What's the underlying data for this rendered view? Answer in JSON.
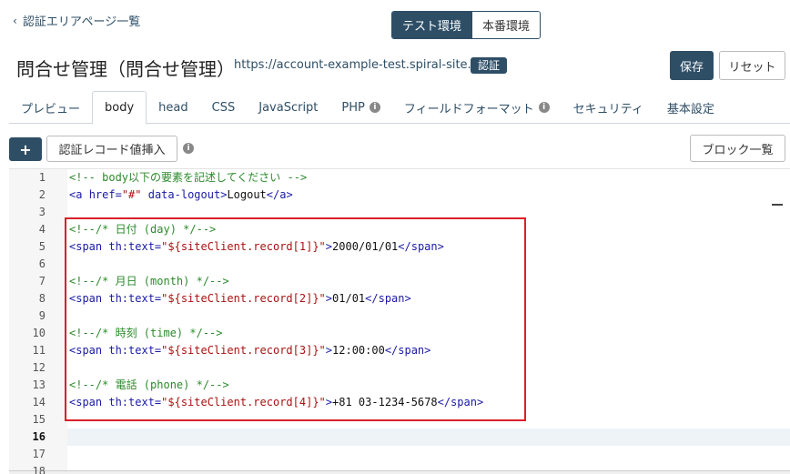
{
  "nav": {
    "back_label": "認証エリアページ一覧"
  },
  "env": {
    "test_label": "テスト環境",
    "prod_label": "本番環境"
  },
  "header": {
    "title": "問合せ管理（問合せ管理）",
    "url": "https://account-example-test.spiral-site.com",
    "badge": "認証",
    "save_label": "保存",
    "reset_label": "リセット"
  },
  "tabs": [
    {
      "label": "プレビュー",
      "info": false
    },
    {
      "label": "body",
      "info": false,
      "active": true
    },
    {
      "label": "head",
      "info": false
    },
    {
      "label": "CSS",
      "info": false
    },
    {
      "label": "JavaScript",
      "info": false
    },
    {
      "label": "PHP",
      "info": true
    },
    {
      "label": "フィールドフォーマット",
      "info": true
    },
    {
      "label": "セキュリティ",
      "info": false
    },
    {
      "label": "基本設定",
      "info": false
    }
  ],
  "toolbar": {
    "plus_label": "+",
    "insert_label": "認証レコード値挿入",
    "block_label": "ブロック一覧"
  },
  "editor": {
    "current_line": 16,
    "line_numbers": [
      "1",
      "2",
      "3",
      "4",
      "5",
      "6",
      "7",
      "8",
      "9",
      "10",
      "11",
      "12",
      "13",
      "14",
      "15",
      "16",
      "17",
      "18"
    ],
    "lines": [
      [
        {
          "t": "comment",
          "v": "<!-- body以下の要素を記述してください -->"
        }
      ],
      [
        {
          "t": "tag",
          "v": "<a "
        },
        {
          "t": "attr",
          "v": "href="
        },
        {
          "t": "str",
          "v": "\"#\""
        },
        {
          "t": "attr",
          "v": " data-logout"
        },
        {
          "t": "tag",
          "v": ">"
        },
        {
          "t": "text",
          "v": "Logout"
        },
        {
          "t": "tag",
          "v": "</a>"
        }
      ],
      [],
      [
        {
          "t": "comment",
          "v": "<!--/* 日付 (day) */-->"
        }
      ],
      [
        {
          "t": "tag",
          "v": "<span "
        },
        {
          "t": "attr",
          "v": "th:text="
        },
        {
          "t": "str",
          "v": "\"${siteClient.record[1]}\""
        },
        {
          "t": "tag",
          "v": ">"
        },
        {
          "t": "text",
          "v": "2000/01/01"
        },
        {
          "t": "tag",
          "v": "</span>"
        }
      ],
      [],
      [
        {
          "t": "comment",
          "v": "<!--/* 月日 (month) */-->"
        }
      ],
      [
        {
          "t": "tag",
          "v": "<span "
        },
        {
          "t": "attr",
          "v": "th:text="
        },
        {
          "t": "str",
          "v": "\"${siteClient.record[2]}\""
        },
        {
          "t": "tag",
          "v": ">"
        },
        {
          "t": "text",
          "v": "01/01"
        },
        {
          "t": "tag",
          "v": "</span>"
        }
      ],
      [],
      [
        {
          "t": "comment",
          "v": "<!--/* 時刻 (time) */-->"
        }
      ],
      [
        {
          "t": "tag",
          "v": "<span "
        },
        {
          "t": "attr",
          "v": "th:text="
        },
        {
          "t": "str",
          "v": "\"${siteClient.record[3]}\""
        },
        {
          "t": "tag",
          "v": ">"
        },
        {
          "t": "text",
          "v": "12:00:00"
        },
        {
          "t": "tag",
          "v": "</span>"
        }
      ],
      [],
      [
        {
          "t": "comment",
          "v": "<!--/* 電話 (phone) */-->"
        }
      ],
      [
        {
          "t": "tag",
          "v": "<span "
        },
        {
          "t": "attr",
          "v": "th:text="
        },
        {
          "t": "str",
          "v": "\"${siteClient.record[4]}\""
        },
        {
          "t": "tag",
          "v": ">"
        },
        {
          "t": "text",
          "v": "+81 03-1234-5678"
        },
        {
          "t": "tag",
          "v": "</span>"
        }
      ],
      [],
      [],
      [],
      []
    ]
  },
  "colors": {
    "accent": "#2e4e66",
    "highlight": "#d9202a"
  },
  "icons": {
    "back": "chevron-left-icon",
    "info": "info-icon",
    "plus": "plus-icon"
  }
}
